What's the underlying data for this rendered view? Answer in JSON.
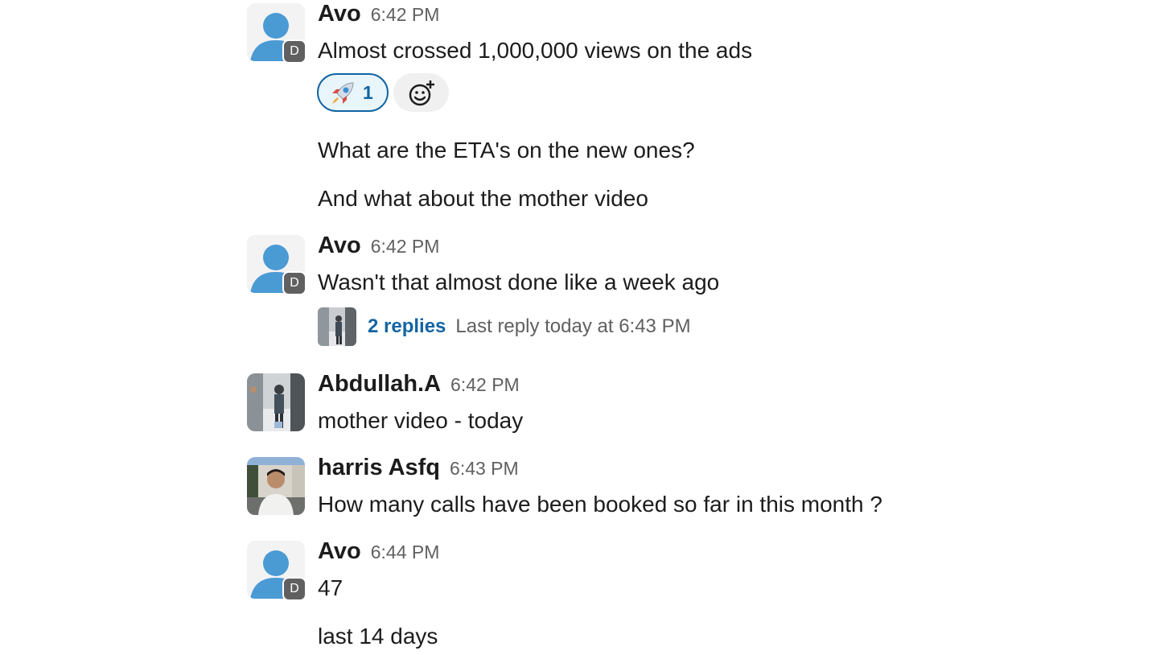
{
  "colors": {
    "link_blue": "#1264a3",
    "reaction_bg": "#e8f5fa",
    "muted_text": "#616061",
    "avatar_blue": "#4a9ad4",
    "badge_grey": "#616061"
  },
  "messages": [
    {
      "sender": "Avo",
      "time": "6:42 PM",
      "avatar": "default-user-icon",
      "badge": "D",
      "lines": [
        "Almost crossed 1,000,000 views on the ads",
        "What are the ETA's on the new ones?",
        "And what about the mother video"
      ],
      "reaction": {
        "emoji": "🚀",
        "icon": "rocket-emoji",
        "count": "1"
      },
      "add_reaction_icon": "add-emoji-icon"
    },
    {
      "sender": "Avo",
      "time": "6:42 PM",
      "avatar": "default-user-icon",
      "badge": "D",
      "lines": [
        "Wasn't that almost done like a week ago"
      ],
      "thread": {
        "replies": "2 replies",
        "last_reply": "Last reply today at 6:43 PM"
      }
    },
    {
      "sender": "Abdullah.A",
      "time": "6:42 PM",
      "avatar": "photo-avatar",
      "lines": [
        "mother video - today"
      ]
    },
    {
      "sender": "harris Asfq",
      "time": "6:43 PM",
      "avatar": "photo-avatar",
      "lines": [
        "How many calls have been booked so far in this month ?"
      ]
    },
    {
      "sender": "Avo",
      "time": "6:44 PM",
      "avatar": "default-user-icon",
      "badge": "D",
      "lines": [
        "47",
        "last 14 days"
      ]
    }
  ]
}
